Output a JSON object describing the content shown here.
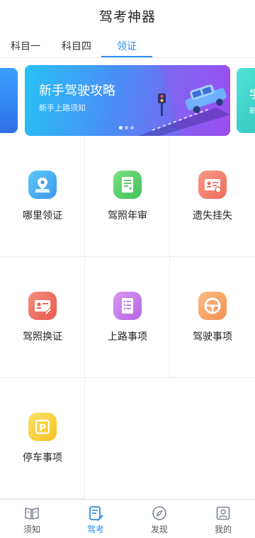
{
  "header": {
    "title": "驾考神器"
  },
  "tabs": [
    {
      "label": "科目一"
    },
    {
      "label": "科目四"
    },
    {
      "label": "领证",
      "active": true
    }
  ],
  "banner": {
    "title": "新手驾驶攻略",
    "subtitle": "新手上路须知",
    "peek_right_text": "学",
    "peek_right_sub": "新",
    "dots": 3,
    "active_dot": 0
  },
  "grid": {
    "items": [
      {
        "label": "哪里领证",
        "icon": "location-map-icon",
        "color": "#4fb2f3"
      },
      {
        "label": "驾照年审",
        "icon": "document-icon",
        "color": "#5fcf6a"
      },
      {
        "label": "遗失挂失",
        "icon": "id-card-icon",
        "color": "#f27a6a"
      },
      {
        "label": "驾照换证",
        "icon": "id-card-edit-icon",
        "color": "#f0705e"
      },
      {
        "label": "上路事项",
        "icon": "checklist-icon",
        "color": "#c67ae8"
      },
      {
        "label": "驾驶事项",
        "icon": "steering-wheel-icon",
        "color": "#f6a56a"
      },
      {
        "label": "停车事项",
        "icon": "parking-icon",
        "color": "#f6cf3c"
      }
    ]
  },
  "bottom_nav": [
    {
      "label": "须知",
      "icon": "book-icon"
    },
    {
      "label": "驾考",
      "icon": "exam-icon",
      "active": true
    },
    {
      "label": "发现",
      "icon": "compass-icon"
    },
    {
      "label": "我的",
      "icon": "profile-icon"
    }
  ],
  "colors": {
    "accent": "#2b8de8"
  }
}
